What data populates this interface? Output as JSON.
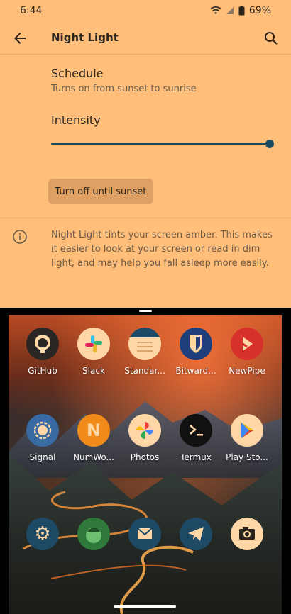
{
  "status_bar": {
    "time": "6:44",
    "battery": "69%"
  },
  "app_bar": {
    "title": "Night Light"
  },
  "settings": {
    "schedule_title": "Schedule",
    "schedule_sub": "Turns on from sunset to sunrise",
    "intensity_title": "Intensity",
    "intensity_value": 1.0,
    "button_label": "Turn off until sunset",
    "info_text": "Night Light tints your screen amber. This makes it easier to look at your screen or read in dim light, and may help you fall asleep more easily."
  },
  "home": {
    "row1": [
      "GitHub",
      "Slack",
      "Standar...",
      "Bitward...",
      "NewPipe"
    ],
    "row2": [
      "Signal",
      "NumWo...",
      "Photos",
      "Termux",
      "Play Sto..."
    ]
  },
  "colors": {
    "accent": "#174b61",
    "amber": "#ffbe7a"
  }
}
